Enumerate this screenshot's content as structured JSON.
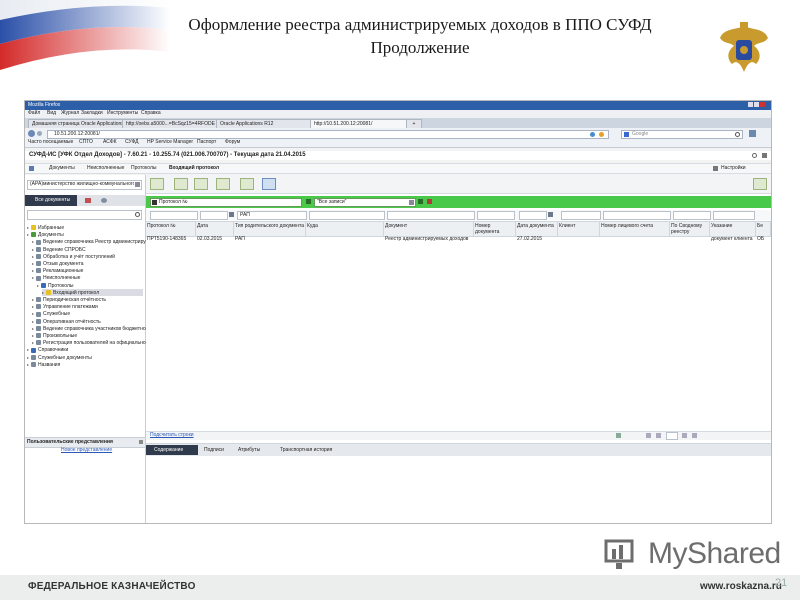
{
  "slide": {
    "title_line1": "Оформление реестра администрируемых доходов в ППО СУФД",
    "title_line2": "Продолжение",
    "footer_left": "ФЕДЕРАЛЬНОЕ КАЗНАЧЕЙСТВО",
    "footer_right": "www.roskazna.ru",
    "page_number": "21",
    "watermark": "MyShared"
  },
  "browser": {
    "app_title": "Mozilla Firefox",
    "menu": [
      "Файл",
      "Вид",
      "Журнал",
      "Закладки",
      "Инструменты",
      "Справка"
    ],
    "tabs": [
      "Домашняя страница Oracle Applications",
      "http://oebs.a5000...=BcSqz15=4RFODE",
      "Oracle Applications R12",
      "http://10.51.200.12:20081/"
    ],
    "url": "10.51.200.12:20081/",
    "search_placeholder": "Google",
    "bookmarks": [
      "Часто посещаемые",
      "СПТО",
      "АСФК",
      "СУФД",
      "HP Service Manager",
      "Паспорт",
      "Форум"
    ]
  },
  "app": {
    "header": "СУФД-ИС [УФК Отдел Доходов] - 7.60.21 - 10.255.74 (021.006.700707) - Текущая дата 21.04.2015",
    "breadcrumb": [
      "Документы",
      "Неисполненные",
      "Протоколы",
      "Входящий протокол"
    ],
    "settings_label": "Настройки"
  },
  "left_panel": {
    "org_value": "(АРА)министерство жилищно-коммунального хозя",
    "tab_all_docs": "Все документы",
    "tree": [
      {
        "label": "Избранные",
        "indent": 1,
        "color": "#e8c020"
      },
      {
        "label": "Документы",
        "indent": 1,
        "color": "#4a9a3a"
      },
      {
        "label": "Ведение справочника Реестр администрируемых",
        "indent": 2,
        "color": "#7a8a9a"
      },
      {
        "label": "Ведение СПРОБС",
        "indent": 2,
        "color": "#7a8a9a"
      },
      {
        "label": "Обработка и учёт поступлений",
        "indent": 2,
        "color": "#7a8a9a"
      },
      {
        "label": "Отзыв документа",
        "indent": 2,
        "color": "#7a8a9a"
      },
      {
        "label": "Рекламационные",
        "indent": 2,
        "color": "#7a8a9a"
      },
      {
        "label": "Неисполненные",
        "indent": 2,
        "color": "#7a8a9a"
      },
      {
        "label": "Протоколы",
        "indent": 3,
        "color": "#3a6ab8"
      },
      {
        "label": "Входящий протокол",
        "indent": 4,
        "color": "#e8c020",
        "selected": true
      },
      {
        "label": "Периодическая отчётность",
        "indent": 2,
        "color": "#7a8a9a"
      },
      {
        "label": "Управление платежами",
        "indent": 2,
        "color": "#7a8a9a"
      },
      {
        "label": "Служебные",
        "indent": 2,
        "color": "#7a8a9a"
      },
      {
        "label": "Оперативная отчётность",
        "indent": 2,
        "color": "#7a8a9a"
      },
      {
        "label": "Ведение справочника участников бюджетного",
        "indent": 2,
        "color": "#7a8a9a"
      },
      {
        "label": "Произвольные",
        "indent": 2,
        "color": "#7a8a9a"
      },
      {
        "label": "Регистрация пользователей на официальном",
        "indent": 2,
        "color": "#7a8a9a"
      },
      {
        "label": "Справочники",
        "indent": 1,
        "color": "#3a6ab8"
      },
      {
        "label": "Служебные документы",
        "indent": 1,
        "color": "#7a8a9a"
      },
      {
        "label": "Названия",
        "indent": 1,
        "color": "#7a8a9a"
      }
    ],
    "user_views_title": "Пользовательские представления",
    "new_view_link": "Новое представление"
  },
  "filters": {
    "doc_type": "Протокол №",
    "record_filter": "\"Все записи\"",
    "column_filter_value": "РАП"
  },
  "table": {
    "columns": [
      "Протокол №",
      "Дата",
      "Тип родительского документа",
      "Кудa",
      "Документ",
      "Номер документа",
      "Дата документа",
      "Клиент",
      "Номер лицевого счета",
      "По Сводному реестру",
      "Указание",
      "Бе"
    ],
    "rows": [
      [
        "ПРТ5190-148365",
        "02.03.2015",
        "РАП",
        "",
        "Реестр администрируемых доходов",
        "",
        "27.02.2015",
        "",
        "",
        "",
        "документ клиента",
        "ОБ"
      ]
    ],
    "footer_link": "Подсчитать строки"
  },
  "bottom_tabs": [
    "Содержание",
    "Подписи",
    "Атрибуты",
    "Транспортная история"
  ],
  "colors": {
    "toolbar_green": "#49c94a",
    "slide_title": "#1a1a1a",
    "footer_bg": "#eceeee"
  }
}
